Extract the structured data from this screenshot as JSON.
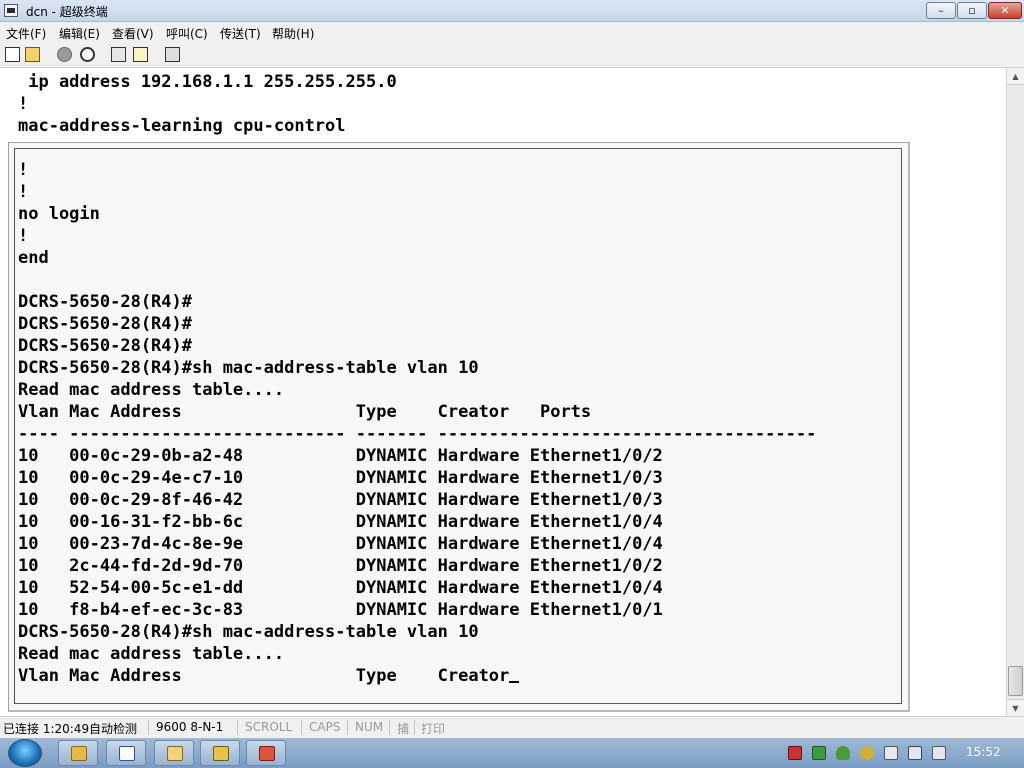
{
  "window": {
    "title": "dcn - 超级终端",
    "minimize": "–",
    "maximize": "▫",
    "close": "✕"
  },
  "menu": [
    "文件(F)",
    "编辑(E)",
    "查看(V)",
    "呼叫(C)",
    "传送(T)",
    "帮助(H)"
  ],
  "toolbar": [
    "new-icon",
    "open-icon",
    "disconnect-icon",
    "call-icon",
    "send-icon",
    "receive-icon",
    "properties-icon"
  ],
  "terminal": {
    "background_lines": [
      " ip address 192.168.1.1 255.255.255.0",
      "!",
      "mac-address-learning cpu-control"
    ],
    "lines": [
      "!",
      "!",
      "no login",
      "!",
      "end",
      "",
      "DCRS-5650-28(R4)#",
      "DCRS-5650-28(R4)#",
      "DCRS-5650-28(R4)#",
      "DCRS-5650-28(R4)#sh mac-address-table vlan 10",
      "Read mac address table....",
      "Vlan Mac Address                 Type    Creator   Ports",
      "---- --------------------------- ------- -------------------------------------",
      "10   00-0c-29-0b-a2-48           DYNAMIC Hardware Ethernet1/0/2",
      "10   00-0c-29-4e-c7-10           DYNAMIC Hardware Ethernet1/0/3",
      "10   00-0c-29-8f-46-42           DYNAMIC Hardware Ethernet1/0/3",
      "10   00-16-31-f2-bb-6c           DYNAMIC Hardware Ethernet1/0/4",
      "10   00-23-7d-4c-8e-9e           DYNAMIC Hardware Ethernet1/0/4",
      "10   2c-44-fd-2d-9d-70           DYNAMIC Hardware Ethernet1/0/2",
      "10   52-54-00-5c-e1-dd           DYNAMIC Hardware Ethernet1/0/4",
      "10   f8-b4-ef-ec-3c-83           DYNAMIC Hardware Ethernet1/0/1",
      "DCRS-5650-28(R4)#sh mac-address-table vlan 10",
      "Read mac address table....",
      "Vlan Mac Address                 Type    Creator"
    ]
  },
  "status": {
    "connected": "已连接 1:20:49",
    "detect": "自动检测",
    "port_settings": "9600 8-N-1",
    "scroll": "SCROLL",
    "caps": "CAPS",
    "num": "NUM",
    "capture": "捕",
    "print": "打印"
  },
  "taskbar": {
    "start": "start-orb-icon",
    "apps": [
      "folder-icon",
      "word-icon",
      "explorer-icon",
      "tools-icon",
      "terminal-app-icon"
    ],
    "clock": "15:52"
  }
}
